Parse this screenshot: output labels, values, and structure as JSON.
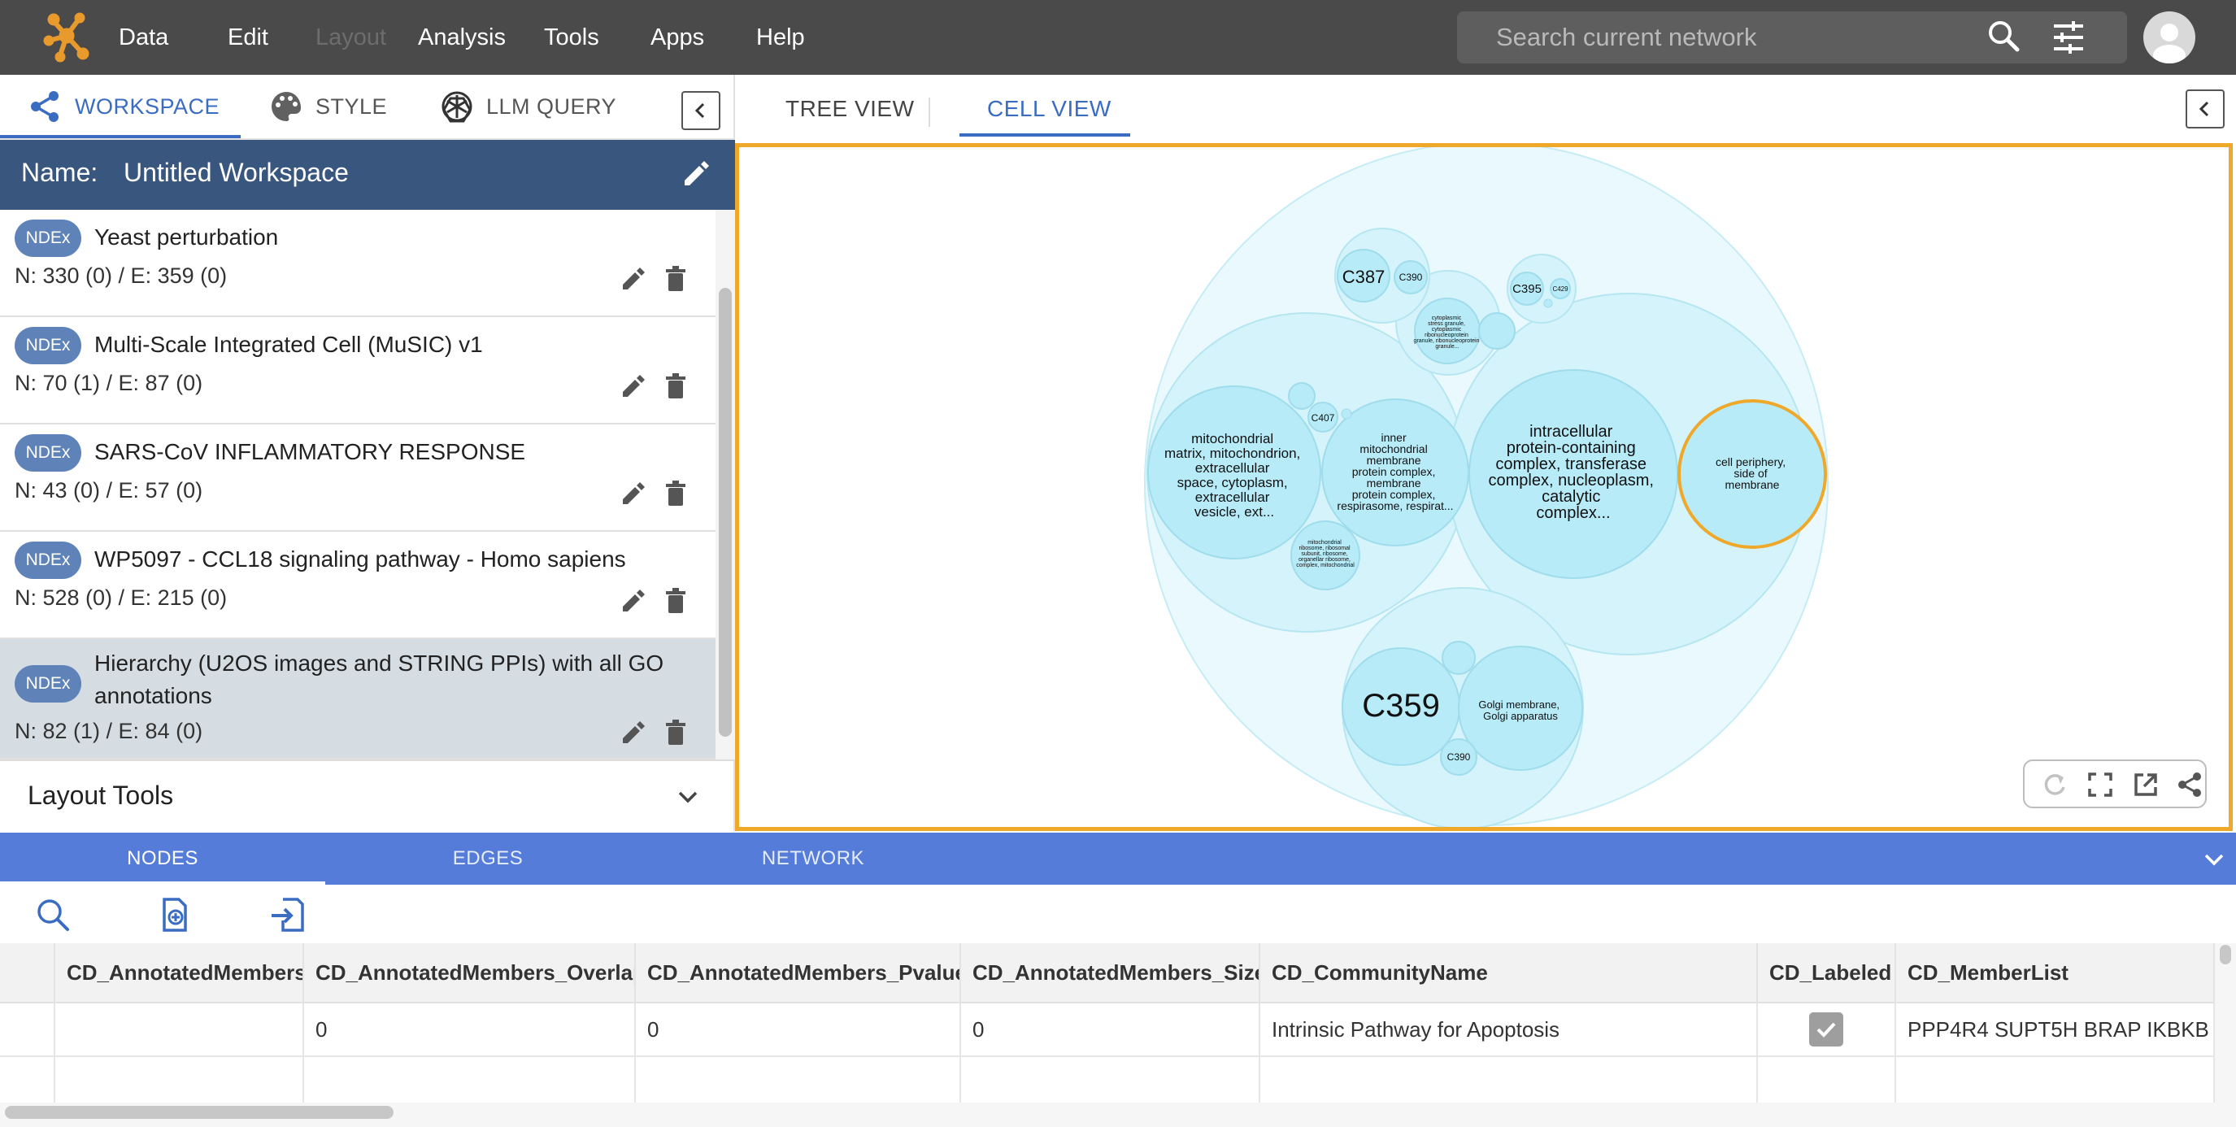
{
  "app": {
    "menu": [
      "Data",
      "Edit",
      "Layout",
      "Analysis",
      "Tools",
      "Apps",
      "Help"
    ],
    "disabled_menu": "Layout",
    "search_placeholder": "Search current network",
    "colors": {
      "topbar": "#4a4a4a",
      "accent": "#3a6cc1",
      "name_bar": "#39567f",
      "selection_border": "#efa82a",
      "bottom_tabs": "#547cd8",
      "logo": "#e89a2c"
    }
  },
  "left_tabs": {
    "workspace": "WORKSPACE",
    "style": "STYLE",
    "llm_query": "LLM QUERY"
  },
  "workspace": {
    "name_label": "Name:",
    "name_value": "Untitled Workspace",
    "networks": [
      {
        "badge": "NDEx",
        "title": "Yeast perturbation",
        "stats": "N: 330 (0) / E: 359 (0)"
      },
      {
        "badge": "NDEx",
        "title": "Multi-Scale Integrated Cell (MuSIC) v1",
        "stats": "N: 70 (1) / E: 87 (0)"
      },
      {
        "badge": "NDEx",
        "title": "SARS-CoV INFLAMMATORY RESPONSE",
        "stats": "N: 43 (0) / E: 57 (0)"
      },
      {
        "badge": "NDEx",
        "title": "WP5097 - CCL18 signaling pathway - Homo sapiens",
        "stats": "N: 528 (0) / E: 215 (0)"
      },
      {
        "badge": "NDEx",
        "title": "Hierarchy (U2OS images and STRING PPIs) with all GO annotations",
        "stats": "N: 82 (1) / E: 84 (0)"
      }
    ],
    "layout_tools": "Layout Tools"
  },
  "right_tabs": {
    "tree_view": "TREE VIEW",
    "cell_view": "CELL VIEW"
  },
  "cell_view": {
    "labels": {
      "c387": "C387",
      "c390_top": "C390",
      "c395": "C395",
      "c429": "C429",
      "c407": "C407",
      "c359": "C359",
      "c390_bottom": "C390",
      "mito": [
        "mitochondrial",
        "matrix, mitochondrion,",
        "extracellular",
        "space, cytoplasm,",
        "extracellular",
        "vesicle, ext..."
      ],
      "inner_mito": [
        "inner",
        "mitochondrial",
        "membrane",
        "protein complex,",
        "membrane",
        "protein complex,",
        "respirasome, respirat..."
      ],
      "intracellular": [
        "intracellular",
        "protein-containing",
        "complex, transferase",
        "complex, nucleoplasm,",
        "catalytic",
        "complex..."
      ],
      "periphery": [
        "cell periphery,",
        "side of",
        "membrane"
      ],
      "golgi": [
        "Golgi membrane,",
        "Golgi apparatus"
      ],
      "cytoplasmic": [
        "cytoplasmic",
        "stress granule,",
        "cytoplasmic",
        "ribonucleoprotein",
        "granule, ribonucleoprotein",
        "granule..."
      ],
      "mito_small": [
        "mitochondrial",
        "ribosome, ribosomal",
        "subunit, ribosome,",
        "organellar ribosome,",
        "complex, mitochondrial"
      ]
    }
  },
  "bottom_tabs": {
    "nodes": "NODES",
    "edges": "EDGES",
    "network": "NETWORK"
  },
  "table": {
    "columns": [
      "CD_AnnotatedMembers",
      "CD_AnnotatedMembers_Overlap",
      "CD_AnnotatedMembers_Pvalue",
      "CD_AnnotatedMembers_Size",
      "CD_CommunityName",
      "CD_Labeled",
      "CD_MemberList"
    ],
    "rows": [
      {
        "CD_AnnotatedMembers": "",
        "CD_AnnotatedMembers_Overlap": "0",
        "CD_AnnotatedMembers_Pvalue": "0",
        "CD_AnnotatedMembers_Size": "0",
        "CD_CommunityName": "Intrinsic Pathway for Apoptosis",
        "CD_Labeled": true,
        "CD_MemberList": "PPP4R4 SUPT5H BRAP IKBKB"
      }
    ]
  }
}
